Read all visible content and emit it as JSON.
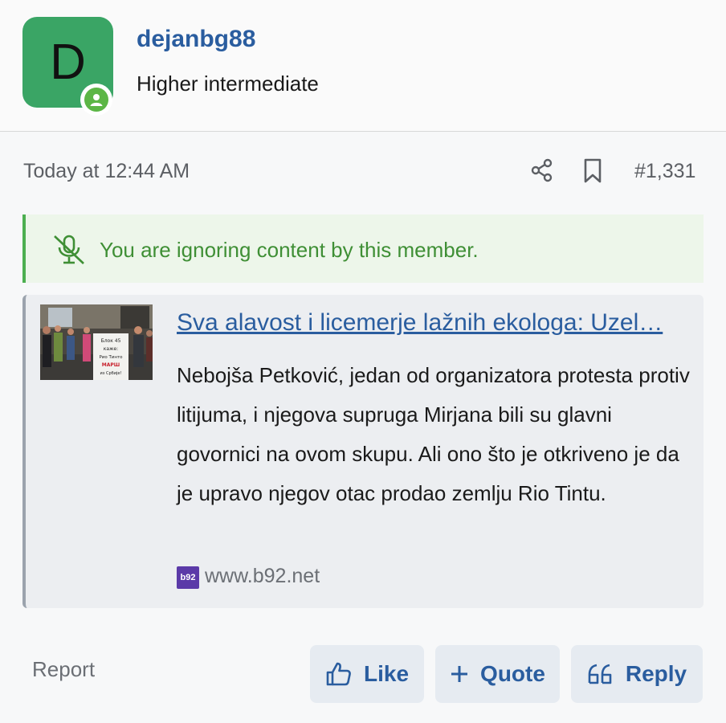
{
  "user": {
    "avatar_letter": "D",
    "username": "dejanbg88",
    "title": "Higher intermediate",
    "avatar_color": "#3aa565",
    "online_status_color": "#5cb646"
  },
  "post": {
    "timestamp": "Today at 12:44 AM",
    "number": "#1,331"
  },
  "ignore_notice": {
    "text": "You are ignoring content by this member."
  },
  "link_preview": {
    "title": "Sva alavost i licemerje lažnih ekologa: Uzel…",
    "description": "Nebojša Petković, jedan od organizatora protesta protiv litijuma, i njegova supruga Mirjana bili su glavni govornici na ovom skupu. Ali ono što je otkriveno je da je upravo njegov otac prodao zemlju Rio Tintu.",
    "domain": "www.b92.net",
    "favicon_text": "b92",
    "thumbnail_sign": [
      "Блок 45",
      "каже:",
      "Рио Тинто",
      "МАРШ",
      "из Србије!"
    ]
  },
  "actions": {
    "report": "Report",
    "like": "Like",
    "quote": "Quote",
    "reply": "Reply"
  },
  "colors": {
    "link": "#2a5d9f",
    "notice_text": "#3f8f35",
    "notice_bg": "#edf6ea"
  }
}
